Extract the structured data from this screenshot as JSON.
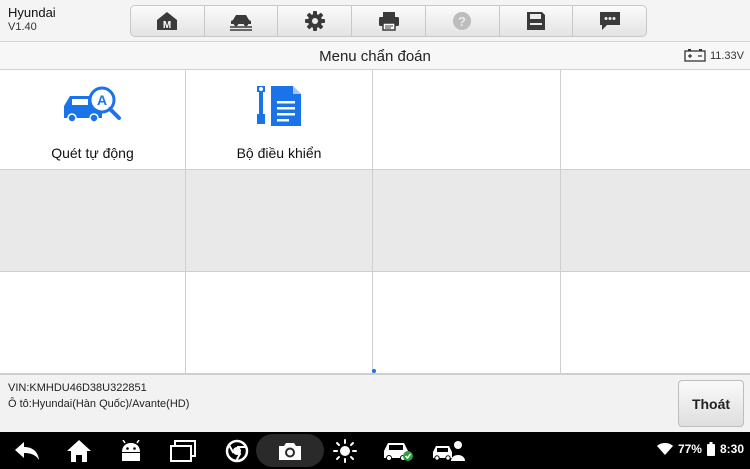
{
  "header": {
    "brand": "Hyundai",
    "version": "V1.40",
    "toolbar": [
      {
        "name": "home-m-icon"
      },
      {
        "name": "vehicle-lift-icon"
      },
      {
        "name": "gear-icon"
      },
      {
        "name": "printer-icon"
      },
      {
        "name": "help-icon"
      },
      {
        "name": "save-icon"
      },
      {
        "name": "message-icon"
      }
    ]
  },
  "titlebar": {
    "title": "Menu chẩn đoán",
    "voltage": "11.33V"
  },
  "menu": {
    "items": [
      {
        "label": "Quét tự động",
        "icon": "auto-scan-car-icon"
      },
      {
        "label": "Bộ điều khiển",
        "icon": "control-unit-icon"
      }
    ]
  },
  "footer": {
    "vin": "VIN:KMHDU46D38U322851",
    "vehicle": "Ô tô:Hyundai(Hàn Quốc)/Avante(HD)",
    "exit_label": "Thoát"
  },
  "system": {
    "battery_percent": "77%",
    "time": "8:30"
  },
  "colors": {
    "accent_blue": "#1a73e8",
    "nav_background": "#000000"
  }
}
